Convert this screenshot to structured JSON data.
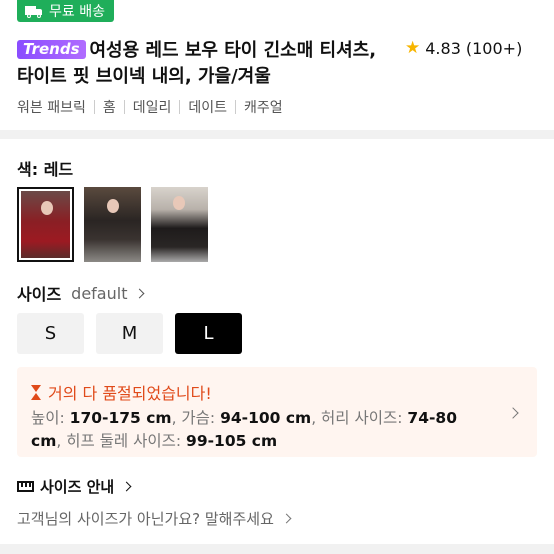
{
  "shipping_badge": {
    "label": "무료 배송",
    "icon": "truck-icon"
  },
  "product": {
    "brand_badge": "Trends",
    "title": "여성용 레드 보우 타이 긴소매 티셔츠, 타이트 핏 브이넥 내의, 가을/겨울",
    "rating": "4.83",
    "review_count": "(100+)",
    "tags": [
      "워븐 패브릭",
      "홈",
      "데일리",
      "데이트",
      "캐주얼"
    ]
  },
  "color": {
    "label": "색: 레드",
    "options": [
      {
        "name": "red",
        "selected": true
      },
      {
        "name": "dark",
        "selected": false
      },
      {
        "name": "black",
        "selected": false
      }
    ]
  },
  "size": {
    "label": "사이즈",
    "default_text": "default",
    "options": [
      "S",
      "M",
      "L"
    ],
    "selected": "L"
  },
  "stock_alert": {
    "title": "거의 다 품절되었습니다!",
    "height_label": "높이: ",
    "height_value": "170-175 cm",
    "chest_label": ", 가슴: ",
    "chest_value": "94-100 cm",
    "waist_label": ", 허리 사이즈: ",
    "waist_value": "74-80",
    "cm_unit": "cm",
    "hip_label": ", 히프 둘레 사이즈: ",
    "hip_value": "99-105 cm"
  },
  "size_guide": {
    "label": "사이즈 안내"
  },
  "size_question": {
    "label": "고객님의 사이즈가 아닌가요? 말해주세요"
  },
  "colors": {
    "accent_green": "#1fae5a",
    "alert_orange": "#e04a1a",
    "star": "#f7b500"
  }
}
